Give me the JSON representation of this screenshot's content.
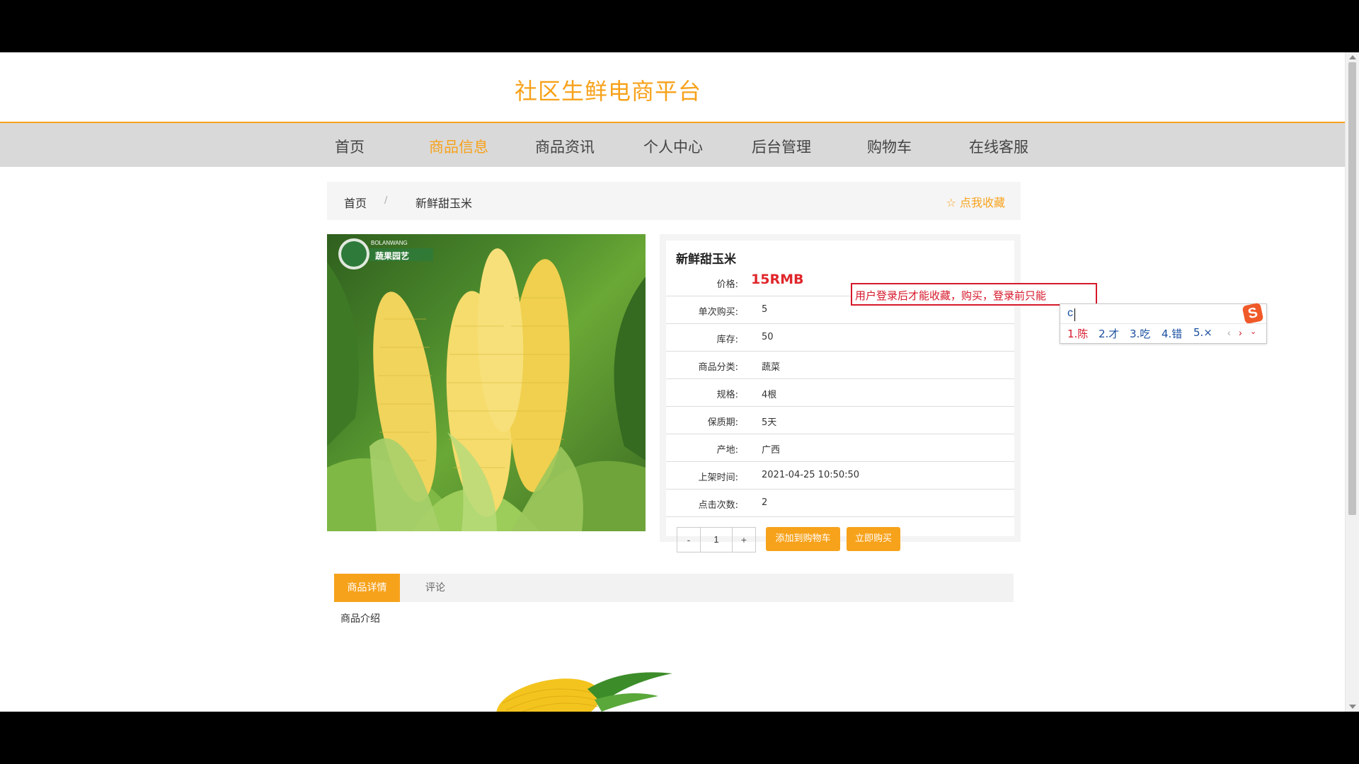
{
  "site": {
    "title": "社区生鲜电商平台"
  },
  "nav": {
    "items": [
      {
        "label": "首页"
      },
      {
        "label": "商品信息"
      },
      {
        "label": "商品资讯"
      },
      {
        "label": "个人中心"
      },
      {
        "label": "后台管理"
      },
      {
        "label": "购物车"
      },
      {
        "label": "在线客服"
      }
    ],
    "active_index": 1
  },
  "breadcrumb": {
    "home": "首页",
    "separator": "/",
    "current": "新鲜甜玉米",
    "favorite_label": "☆ 点我收藏"
  },
  "product": {
    "name": "新鲜甜玉米",
    "price_label": "价格:",
    "price": "15RMB",
    "rows": [
      {
        "label": "单次购买:",
        "value": "5"
      },
      {
        "label": "库存:",
        "value": "50"
      },
      {
        "label": "商品分类:",
        "value": "蔬菜"
      },
      {
        "label": "规格:",
        "value": "4根"
      },
      {
        "label": "保质期:",
        "value": "5天"
      },
      {
        "label": "产地:",
        "value": "广西"
      },
      {
        "label": "上架时间:",
        "value": "2021-04-25 10:50:50"
      },
      {
        "label": "点击次数:",
        "value": "2"
      }
    ],
    "image_brand": "蔬果园艺",
    "image_brand_en": "BOLANWANG"
  },
  "purchase": {
    "minus": "-",
    "quantity": "1",
    "plus": "+",
    "add_to_cart": "添加到购物车",
    "buy_now": "立即购买"
  },
  "tabs": {
    "details": "商品详情",
    "comments": "评论",
    "intro": "商品介绍"
  },
  "tooltip": {
    "text": "用户登录后才能收藏，购买，登录前只能"
  },
  "ime": {
    "input": "c",
    "candidates": [
      "1.陈",
      "2.才",
      "3.吃",
      "4.错",
      "5.×"
    ],
    "logo": "S"
  },
  "colors": {
    "accent": "#f7a21b",
    "price": "#e0262b",
    "tooltip_border": "#d6182a",
    "nav_bg": "#d9d9d9"
  }
}
